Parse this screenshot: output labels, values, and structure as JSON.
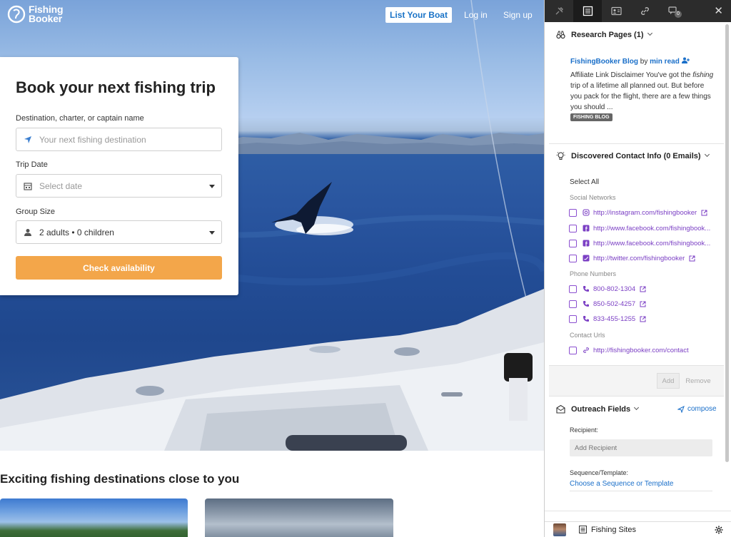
{
  "site": {
    "logo": {
      "line1": "Fishing",
      "line2": "Booker"
    },
    "nav": {
      "list_boat": "List Your Boat",
      "login": "Log in",
      "signup": "Sign up"
    },
    "search": {
      "title": "Book your next fishing trip",
      "destination_label": "Destination, charter, or captain name",
      "destination_placeholder": "Your next fishing destination",
      "date_label": "Trip Date",
      "date_placeholder": "Select date",
      "group_label": "Group Size",
      "group_value": "2 adults • 0 children",
      "button": "Check availability"
    },
    "section_title": "Exciting fishing destinations close to you"
  },
  "extension": {
    "toolbar": {
      "badge_count": "0",
      "icons": [
        "pin-icon",
        "list-icon",
        "contact-card-icon",
        "link-icon",
        "chat-icon"
      ]
    },
    "research": {
      "header": "Research Pages (1)",
      "blog_name": "FishingBooker Blog",
      "by": "by",
      "author": "min read",
      "excerpt_pre": "Affiliate Link Disclaimer You've got the ",
      "excerpt_em": "fishing",
      "excerpt_post": " trip of a lifetime all planned out. But before you pack for the flight, there are a few things you should ...",
      "tag": "FISHING BLOG"
    },
    "contacts": {
      "header": "Discovered Contact Info (0 Emails)",
      "select_all": "Select All",
      "social_label": "Social Networks",
      "social": [
        {
          "icon": "instagram-icon",
          "text": "http://instagram.com/fishingbooker"
        },
        {
          "icon": "facebook-icon",
          "text": "http://www.facebook.com/fishingbook..."
        },
        {
          "icon": "facebook-icon",
          "text": "http://www.facebook.com/fishingbook..."
        },
        {
          "icon": "twitter-icon",
          "text": "http://twitter.com/fishingbooker"
        }
      ],
      "phone_label": "Phone Numbers",
      "phones": [
        "800-802-1304",
        "850-502-4257",
        "833-455-1255"
      ],
      "url_label": "Contact Urls",
      "urls": [
        "http://fishingbooker.com/contact"
      ],
      "add": "Add",
      "remove": "Remove"
    },
    "outreach": {
      "header": "Outreach Fields",
      "compose": "compose",
      "recipient_label": "Recipient:",
      "recipient_placeholder": "Add Recipient",
      "sequence_label": "Sequence/Template:",
      "sequence_link": "Choose a Sequence or Template"
    },
    "footer": {
      "label": "Fishing Sites"
    },
    "colors": {
      "link": "#1a6fc9",
      "contact": "#7b3fc4",
      "toolbar": "#2c2c2c",
      "cta": "#f3a64a"
    }
  }
}
